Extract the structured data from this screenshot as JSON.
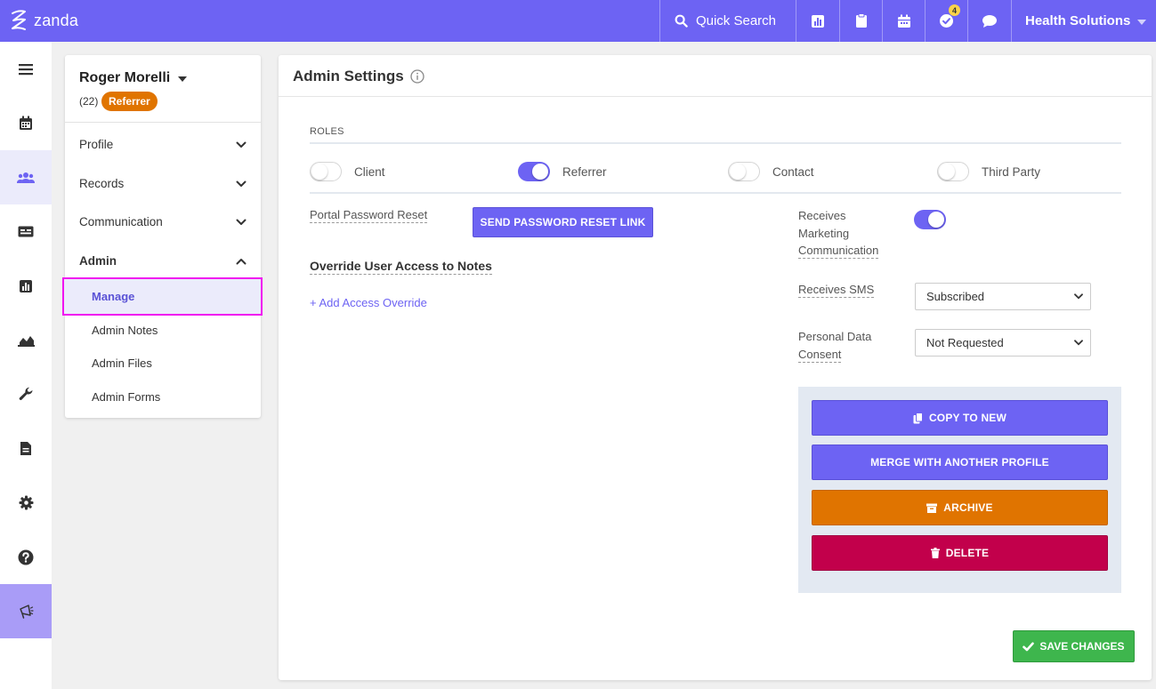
{
  "brand": {
    "name": "zanda"
  },
  "topbar": {
    "quick_search_label": "Quick Search",
    "notification_count": "4",
    "org_name": "Health Solutions",
    "accent": "#6d63f3"
  },
  "profile": {
    "name": "Roger Morelli",
    "count": "(22)",
    "role_badge": "Referrer",
    "menu": [
      {
        "label": "Profile"
      },
      {
        "label": "Records"
      },
      {
        "label": "Communication"
      },
      {
        "label": "Admin"
      }
    ],
    "admin_items": [
      "Manage",
      "Admin Notes",
      "Admin Files",
      "Admin Forms"
    ]
  },
  "admin": {
    "title": "Admin Settings",
    "roles_label": "ROLES",
    "roles": [
      {
        "label": "Client",
        "on": false
      },
      {
        "label": "Referrer",
        "on": true
      },
      {
        "label": "Contact",
        "on": false
      },
      {
        "label": "Third Party",
        "on": false
      }
    ],
    "portal_reset_label": "Portal Password Reset",
    "send_reset_button": "SEND PASSWORD RESET LINK",
    "override_label": "Override User Access to Notes",
    "add_override_link": "+ Add Access Override",
    "marketing_label": [
      "Receives",
      "Marketing",
      "Communication"
    ],
    "marketing_on": true,
    "sms_label": "Receives SMS",
    "sms_value": "Subscribed",
    "consent_label": [
      "Personal Data",
      "Consent"
    ],
    "consent_value": "Not Requested",
    "actions": {
      "copy": "COPY TO NEW",
      "merge": "MERGE WITH ANOTHER PROFILE",
      "archive": "ARCHIVE",
      "delete": "DELETE"
    },
    "save_button": "SAVE CHANGES"
  },
  "colors": {
    "primary": "#6d63f3",
    "archive": "#e07400",
    "delete": "#c2004b",
    "save": "#3eb64d",
    "highlight_border": "#f011f0"
  }
}
